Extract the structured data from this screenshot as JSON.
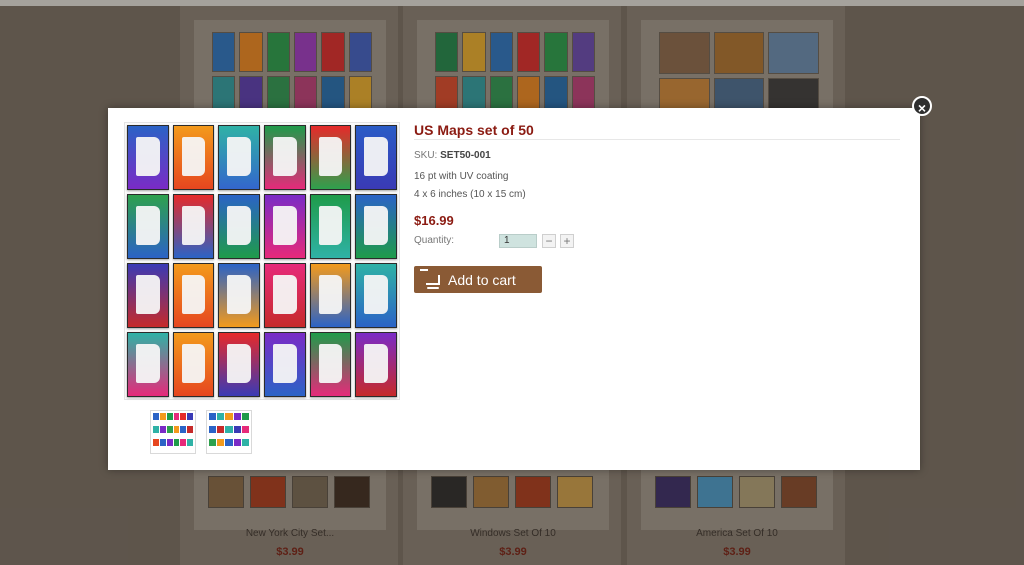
{
  "background_products": [
    {
      "title": "New York City Set...",
      "price": "$3.99"
    },
    {
      "title": "Windows Set Of 10",
      "price": "$3.99"
    },
    {
      "title": "America Set Of 10",
      "price": "$3.99"
    }
  ],
  "modal": {
    "title": "US Maps set of 50",
    "sku_label": "SKU:",
    "sku_value": "SET50-001",
    "desc_1": "16 pt with UV coating",
    "desc_2": "4 x 6 inches (10 x 15 cm)",
    "price": "$16.99",
    "quantity_label": "Quantity:",
    "quantity_value": "1",
    "minus_label": "−",
    "plus_label": "+",
    "add_to_cart_label": "Add to cart",
    "close_label": "×"
  },
  "colors": {
    "accent": "#8b1b12",
    "button": "#8a5a35"
  },
  "icons": [
    "close-icon",
    "shopping-cart-icon"
  ]
}
